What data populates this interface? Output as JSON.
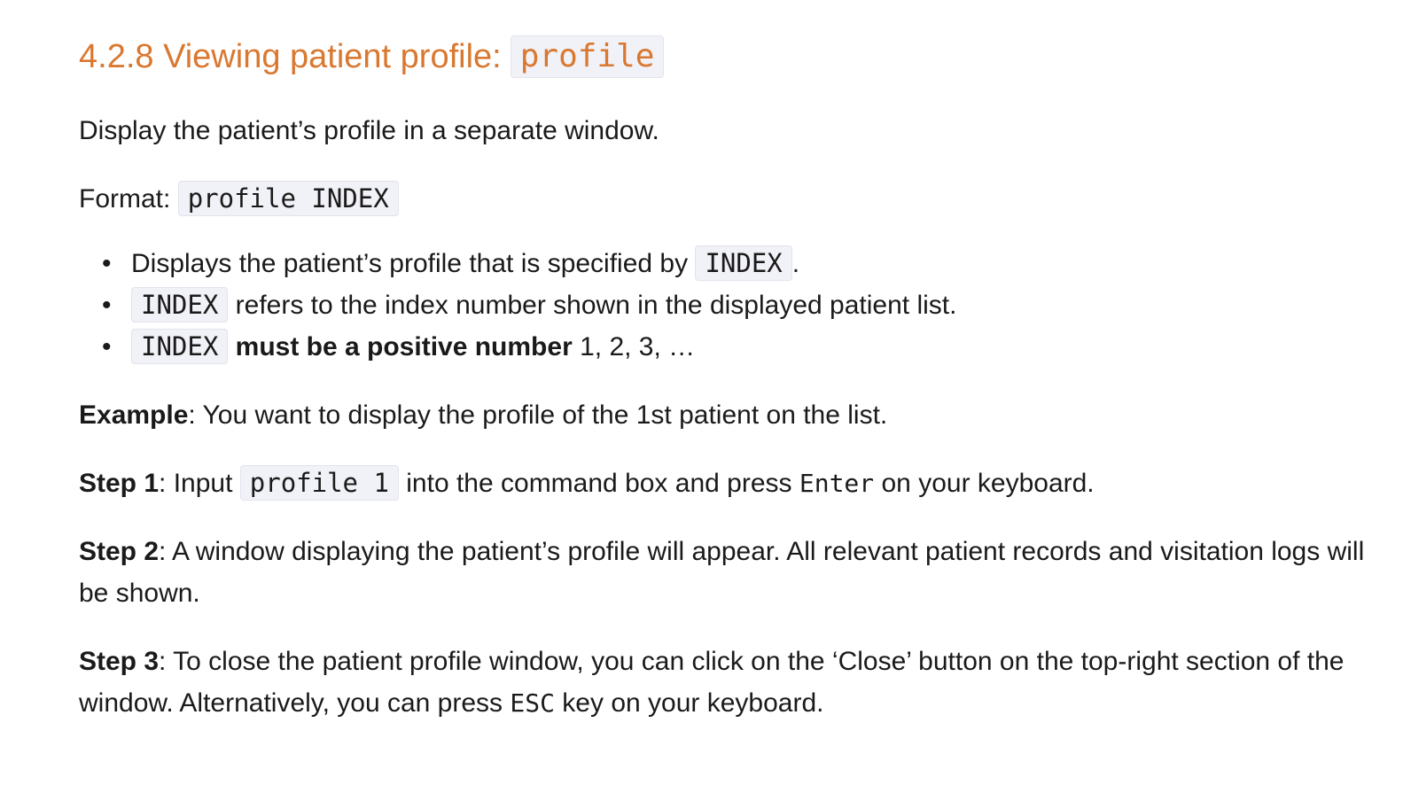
{
  "heading": {
    "text": "4.2.8 Viewing patient profile:",
    "code": "profile"
  },
  "intro": "Display the patient’s profile in a separate window.",
  "format": {
    "label": "Format:",
    "code": "profile INDEX"
  },
  "bullets": [
    {
      "text_before": "Displays the patient’s profile that is specified by",
      "code": "INDEX",
      "text_after": "."
    },
    {
      "code": "INDEX",
      "text": "refers to the index number shown in the displayed patient list."
    },
    {
      "code": "INDEX",
      "bold": "must be a positive number",
      "text": "1, 2, 3, …"
    }
  ],
  "example": {
    "label": "Example",
    "text": ": You want to display the profile of the 1st patient on the list."
  },
  "step1": {
    "label": "Step 1",
    "text_before": ": Input",
    "code": "profile 1",
    "text_middle": "into the command box and press",
    "key": "Enter",
    "text_after": "on your keyboard."
  },
  "step2": {
    "label": "Step 2",
    "text": ": A window displaying the patient’s profile will appear. All relevant patient records and visitation logs will be shown."
  },
  "step3": {
    "label": "Step 3",
    "text_before": ": To close the patient profile window, you can click on the ‘Close’ button on the top-right section of the window. Alternatively, you can press",
    "key": "ESC",
    "text_after": "key on your keyboard."
  },
  "colors": {
    "heading": "#d97830",
    "code_background": "#f1f1f8",
    "text": "#1a1a1a"
  }
}
